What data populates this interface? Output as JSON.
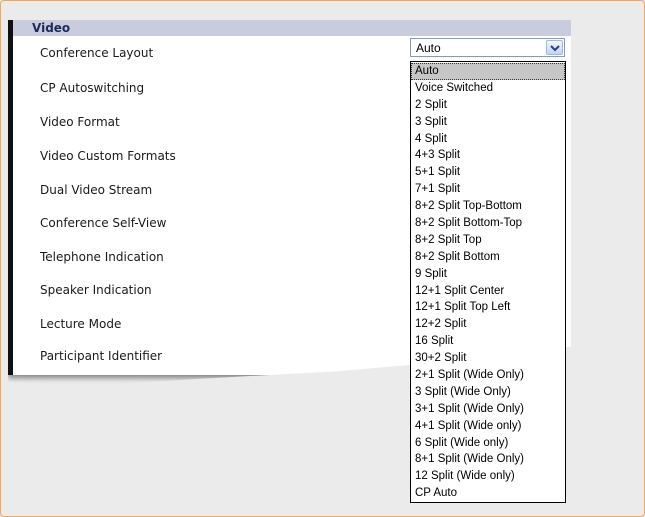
{
  "section": {
    "title": "Video"
  },
  "settings": [
    {
      "label": "Conference Layout"
    },
    {
      "label": "CP Autoswitching"
    },
    {
      "label": "Video Format"
    },
    {
      "label": "Video Custom Formats"
    },
    {
      "label": "Dual Video Stream"
    },
    {
      "label": "Conference Self-View"
    },
    {
      "label": "Telephone Indication"
    },
    {
      "label": "Speaker Indication"
    },
    {
      "label": "Lecture Mode"
    },
    {
      "label": "Participant Identifier"
    }
  ],
  "conference_layout_select": {
    "value": "Auto",
    "options": [
      "Auto",
      "Voice Switched",
      "2 Split",
      "3 Split",
      "4 Split",
      "4+3 Split",
      "5+1 Split",
      "7+1 Split",
      "8+2 Split Top-Bottom",
      "8+2 Split Bottom-Top",
      "8+2 Split Top",
      "8+2 Split Bottom",
      "9 Split",
      "12+1 Split Center",
      "12+1 Split Top Left",
      "12+2 Split",
      "16 Split",
      "30+2 Split",
      "2+1 Split (Wide Only)",
      "3 Split (Wide Only)",
      "3+1 Split (Wide Only)",
      "4+1 Split (Wide only)",
      "6 Split (Wide only)",
      "8+1 Split (Wide Only)",
      "12 Split (Wide only)",
      "CP Auto"
    ],
    "selected_index": 0
  },
  "colors": {
    "header_bg": "#c8ccde",
    "header_text": "#1d2a5a",
    "frame_border": "#f2a65a",
    "selected_option_bg": "#c6c6c6"
  }
}
